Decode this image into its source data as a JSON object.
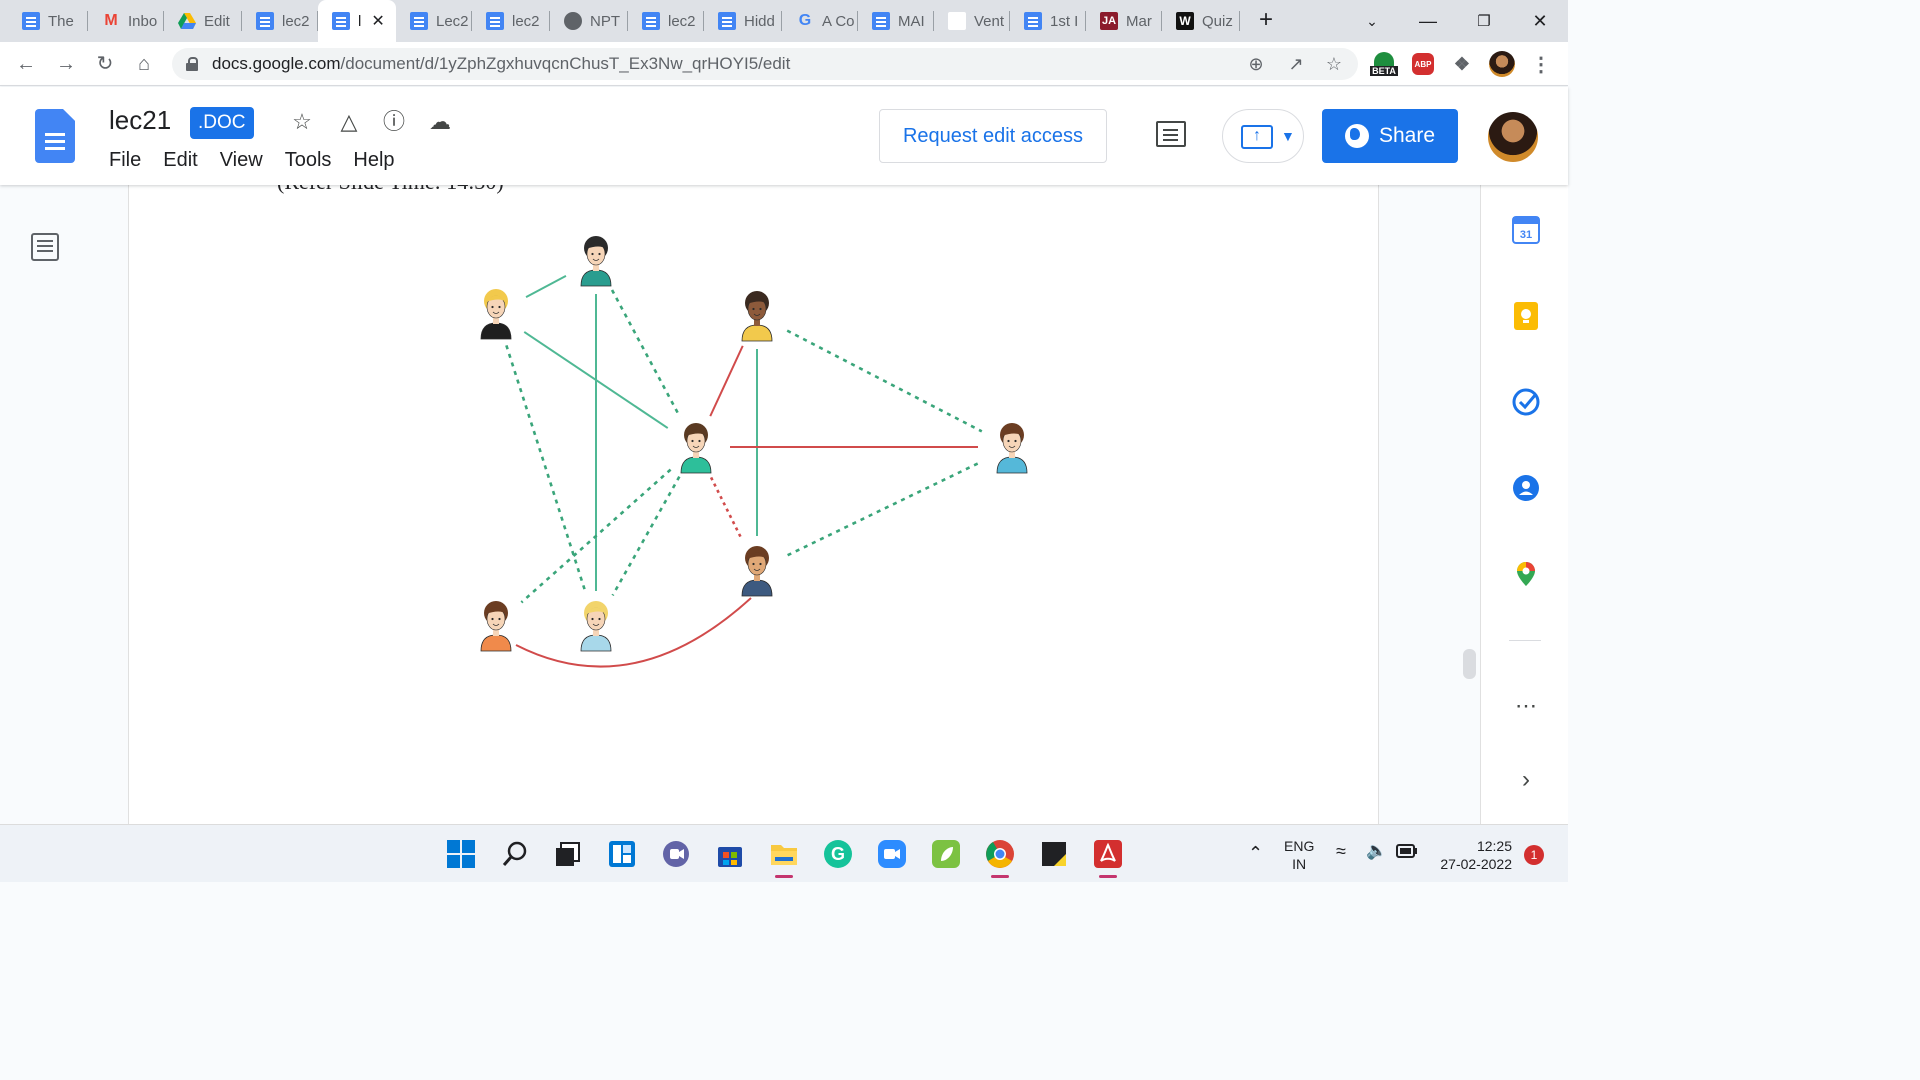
{
  "browser": {
    "tabs": [
      {
        "label": "The",
        "icon": "docs-icon",
        "active": false
      },
      {
        "label": "Inbo",
        "icon": "gmail-icon",
        "active": false
      },
      {
        "label": "Edit",
        "icon": "drive-icon",
        "active": false
      },
      {
        "label": "lec2",
        "icon": "docs-icon",
        "active": false
      },
      {
        "label": "l",
        "icon": "docs-icon",
        "active": true
      },
      {
        "label": "Lec2",
        "icon": "docs-icon",
        "active": false
      },
      {
        "label": "lec2",
        "icon": "docs-icon",
        "active": false
      },
      {
        "label": "NPT",
        "icon": "globe-icon",
        "active": false
      },
      {
        "label": "lec2",
        "icon": "docs-icon",
        "active": false
      },
      {
        "label": "Hidd",
        "icon": "docs-icon",
        "active": false
      },
      {
        "label": "A Co",
        "icon": "google-icon",
        "active": false
      },
      {
        "label": "MAI",
        "icon": "docs-icon",
        "active": false
      },
      {
        "label": "Vent",
        "icon": "blank-icon",
        "active": false
      },
      {
        "label": "1st I",
        "icon": "docs-icon",
        "active": false
      },
      {
        "label": "Mar",
        "icon": "ja-icon",
        "active": false
      },
      {
        "label": "Quiz",
        "icon": "w-icon",
        "active": false
      }
    ],
    "new_tab_label": "+",
    "url_host": "docs.google.com",
    "url_path": "/document/d/1yZphZgxhuvqcnChusT_Ex3Nw_qrHOYI5/edit",
    "ext_badge_beta": "BETA",
    "ext_badge_abp": "ABP"
  },
  "docs": {
    "title": "lec21",
    "badge": ".DOC",
    "menu": [
      "File",
      "Edit",
      "View",
      "Tools",
      "Help"
    ],
    "request_edit_label": "Request edit access",
    "share_label": "Share",
    "clipped_text": "(Refer Slide Time: 14:30)"
  },
  "diagram": {
    "nodes": [
      {
        "id": "woman-dark-hair",
        "skin": "#f6d5b8",
        "hair": "#2b2b2b",
        "shirt": "#2a9d8f"
      },
      {
        "id": "woman-blonde-curly",
        "skin": "#f6d5b8",
        "hair": "#f2c94c",
        "shirt": "#1f1f1f"
      },
      {
        "id": "man-dark-skin",
        "skin": "#8d5a3b",
        "hair": "#3b2a20",
        "shirt": "#f2c94c"
      },
      {
        "id": "man-center",
        "skin": "#f6d5b8",
        "hair": "#5a3a22",
        "shirt": "#2dbf9a"
      },
      {
        "id": "woman-right",
        "skin": "#f6d5b8",
        "hair": "#6b3d22",
        "shirt": "#55b8d9"
      },
      {
        "id": "man-bottom-right",
        "skin": "#e0a877",
        "hair": "#6b3d22",
        "shirt": "#3d5a80"
      },
      {
        "id": "man-glasses",
        "skin": "#f6d5b8",
        "hair": "#6b3d22",
        "shirt": "#f08a4b"
      },
      {
        "id": "woman-blonde-bottom",
        "skin": "#f6d5b8",
        "hair": "#f2d46b",
        "shirt": "#a8d8ea"
      }
    ],
    "edges": [
      {
        "from": "woman-blonde-curly",
        "to": "woman-dark-hair",
        "style": "solid",
        "color": "#4fb894"
      },
      {
        "from": "woman-blonde-curly",
        "to": "man-center",
        "style": "solid",
        "color": "#4fb894"
      },
      {
        "from": "woman-dark-hair",
        "to": "woman-blonde-bottom",
        "style": "solid",
        "color": "#4fb894"
      },
      {
        "from": "woman-dark-hair",
        "to": "man-center",
        "style": "dashed",
        "color": "#3aa57a"
      },
      {
        "from": "woman-blonde-curly",
        "to": "woman-blonde-bottom",
        "style": "dashed",
        "color": "#3aa57a"
      },
      {
        "from": "man-center",
        "to": "man-glasses",
        "style": "dashed",
        "color": "#3aa57a"
      },
      {
        "from": "man-center",
        "to": "woman-blonde-bottom",
        "style": "dashed",
        "color": "#3aa57a"
      },
      {
        "from": "man-dark-skin",
        "to": "woman-right",
        "style": "dashed",
        "color": "#3aa57a"
      },
      {
        "from": "man-bottom-right",
        "to": "woman-right",
        "style": "dashed",
        "color": "#3aa57a"
      },
      {
        "from": "man-dark-skin",
        "to": "man-bottom-right",
        "style": "solid",
        "color": "#4fb894"
      },
      {
        "from": "man-center",
        "to": "man-dark-skin",
        "style": "solid",
        "color": "#d14b4b"
      },
      {
        "from": "man-center",
        "to": "woman-right",
        "style": "solid",
        "color": "#d14b4b"
      },
      {
        "from": "man-center",
        "to": "man-bottom-right",
        "style": "dotted",
        "color": "#d14b4b"
      },
      {
        "from": "man-glasses",
        "to": "man-bottom-right",
        "style": "curve",
        "color": "#d14b4b"
      }
    ]
  },
  "taskbar": {
    "lang_top": "ENG",
    "lang_bottom": "IN",
    "time": "12:25",
    "date": "27-02-2022",
    "notifications": "1"
  },
  "colors": {
    "accent": "#1a73e8",
    "docs_blue": "#4285f4",
    "tab_bar": "#dee1e6"
  }
}
